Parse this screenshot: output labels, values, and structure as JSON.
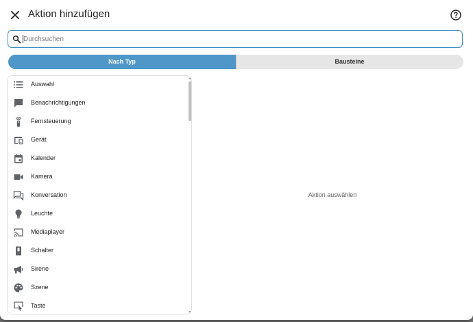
{
  "dialog": {
    "title": "Aktion hinzufügen",
    "close_icon": "close-icon",
    "help_icon": "help-circle-icon"
  },
  "search": {
    "placeholder": "Durchsuchen",
    "value": ""
  },
  "tabs": [
    {
      "label": "Nach Typ",
      "active": true
    },
    {
      "label": "Bausteine",
      "active": false
    }
  ],
  "list": {
    "items": [
      {
        "label": "Auswahl",
        "icon": "list-icon"
      },
      {
        "label": "Benachrichtigungen",
        "icon": "message-icon"
      },
      {
        "label": "Fernsteuerung",
        "icon": "remote-icon"
      },
      {
        "label": "Gerät",
        "icon": "devices-icon"
      },
      {
        "label": "Kalender",
        "icon": "calendar-icon"
      },
      {
        "label": "Kamera",
        "icon": "camera-icon"
      },
      {
        "label": "Konversation",
        "icon": "forum-icon"
      },
      {
        "label": "Leuchte",
        "icon": "lightbulb-icon"
      },
      {
        "label": "Mediaplayer",
        "icon": "cast-icon"
      },
      {
        "label": "Schalter",
        "icon": "switch-icon"
      },
      {
        "label": "Sirene",
        "icon": "bullhorn-icon"
      },
      {
        "label": "Szene",
        "icon": "palette-icon"
      },
      {
        "label": "Taste",
        "icon": "gesture-tap-button-icon"
      }
    ]
  },
  "detail": {
    "empty_message": "Aktion auswählen"
  },
  "colors": {
    "accent": "#4f97c9",
    "search_border": "#3d8ec4",
    "icon": "#5f6368",
    "text": "#202124"
  }
}
